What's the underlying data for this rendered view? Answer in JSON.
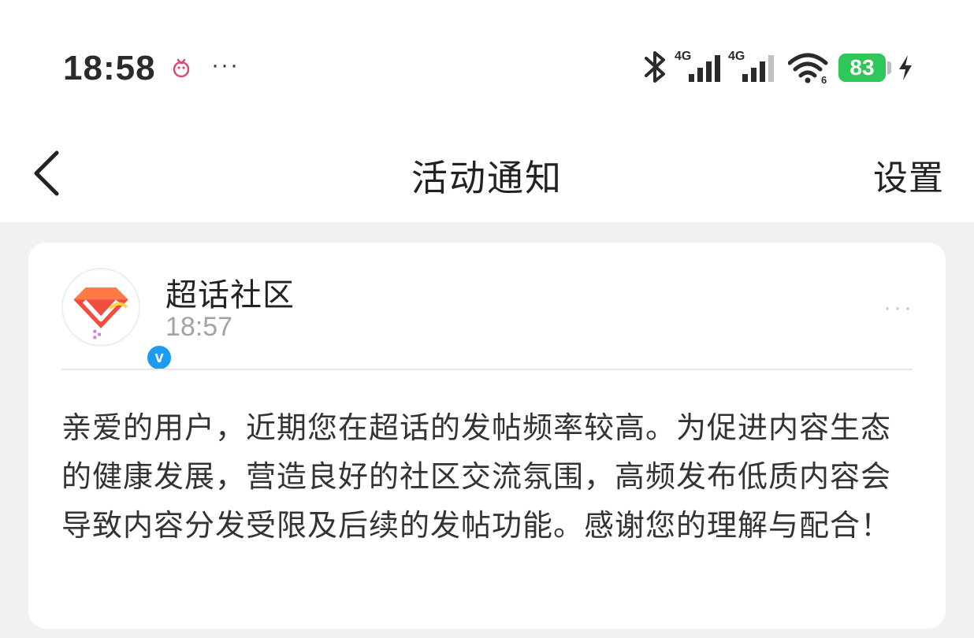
{
  "status_bar": {
    "time": "18:58",
    "more": "···",
    "signal1_label": "4G",
    "signal2_label": "4G",
    "wifi_label": "6",
    "battery": "83",
    "icons": [
      "notification-app-icon",
      "bluetooth-icon",
      "signal-icon",
      "signal-icon",
      "wifi-icon",
      "battery-icon",
      "charging-icon"
    ],
    "battery_color": "#2fc65a"
  },
  "header": {
    "title": "活动通知",
    "settings_label": "设置",
    "back_icon": "chevron-left-icon"
  },
  "notification": {
    "sender": "超话社区",
    "time": "18:57",
    "verified_label": "v",
    "more": "···",
    "message": "亲爱的用户，近期您在超话的发帖频率较高。为促进内容生态的健康发展，营造良好的社区交流氛围，高频发布低质内容会导致内容分发受限及后续的发帖功能。感谢您的理解与配合！",
    "accent_color": "#1d9bf0"
  }
}
